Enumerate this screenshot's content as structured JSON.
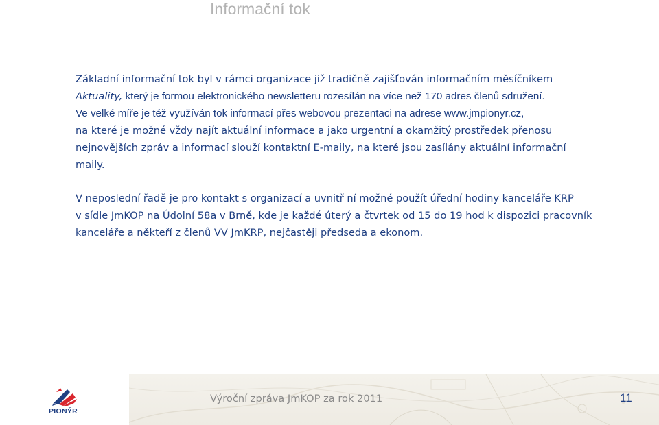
{
  "title": "Informační tok",
  "paragraph1": {
    "line1_part1": "Základní informační tok byl v rámci organizace již tradičně zajišťován informačním měsíčníkem",
    "line2_italic": "Aktuality,",
    "line2_rest": " který je formou elektronického newsletteru rozesílán na více než 170 adres členů sdružení.",
    "line3": "Ve velké míře je též využíván tok informací přes webovou prezentaci na adrese www.jmpionyr.cz,",
    "line4": "na které je možné vždy najít aktuální informace a jako urgentní a okamžitý prostředek přenosu",
    "line5": "nejnovějších zpráv a informací slouží kontaktní E-maily, na které jsou zasílány aktuální informační",
    "line6": "maily."
  },
  "paragraph2": {
    "line1": "V neposlední řadě je pro kontakt s organizací a uvnitř ní možné použít úřední hodiny kanceláře KRP",
    "line2": "v sídle JmKOP na Údolní 58a v Brně, kde je každé úterý a čtvrtek od 15 do 19 hod k dispozici pracovník",
    "line3": "kanceláře a někteří z členů VV JmKRP, nejčastěji předseda a ekonom."
  },
  "footer": {
    "report_title": "Výroční zpráva JmKOP za rok 2011",
    "page_number": "11",
    "logo_text": "PIONÝR"
  },
  "colors": {
    "text": "#1f3f82",
    "title": "#b3b3b3",
    "footer_text": "#8a8a8a",
    "logo_red": "#d9262e",
    "logo_blue": "#1f3f82"
  }
}
